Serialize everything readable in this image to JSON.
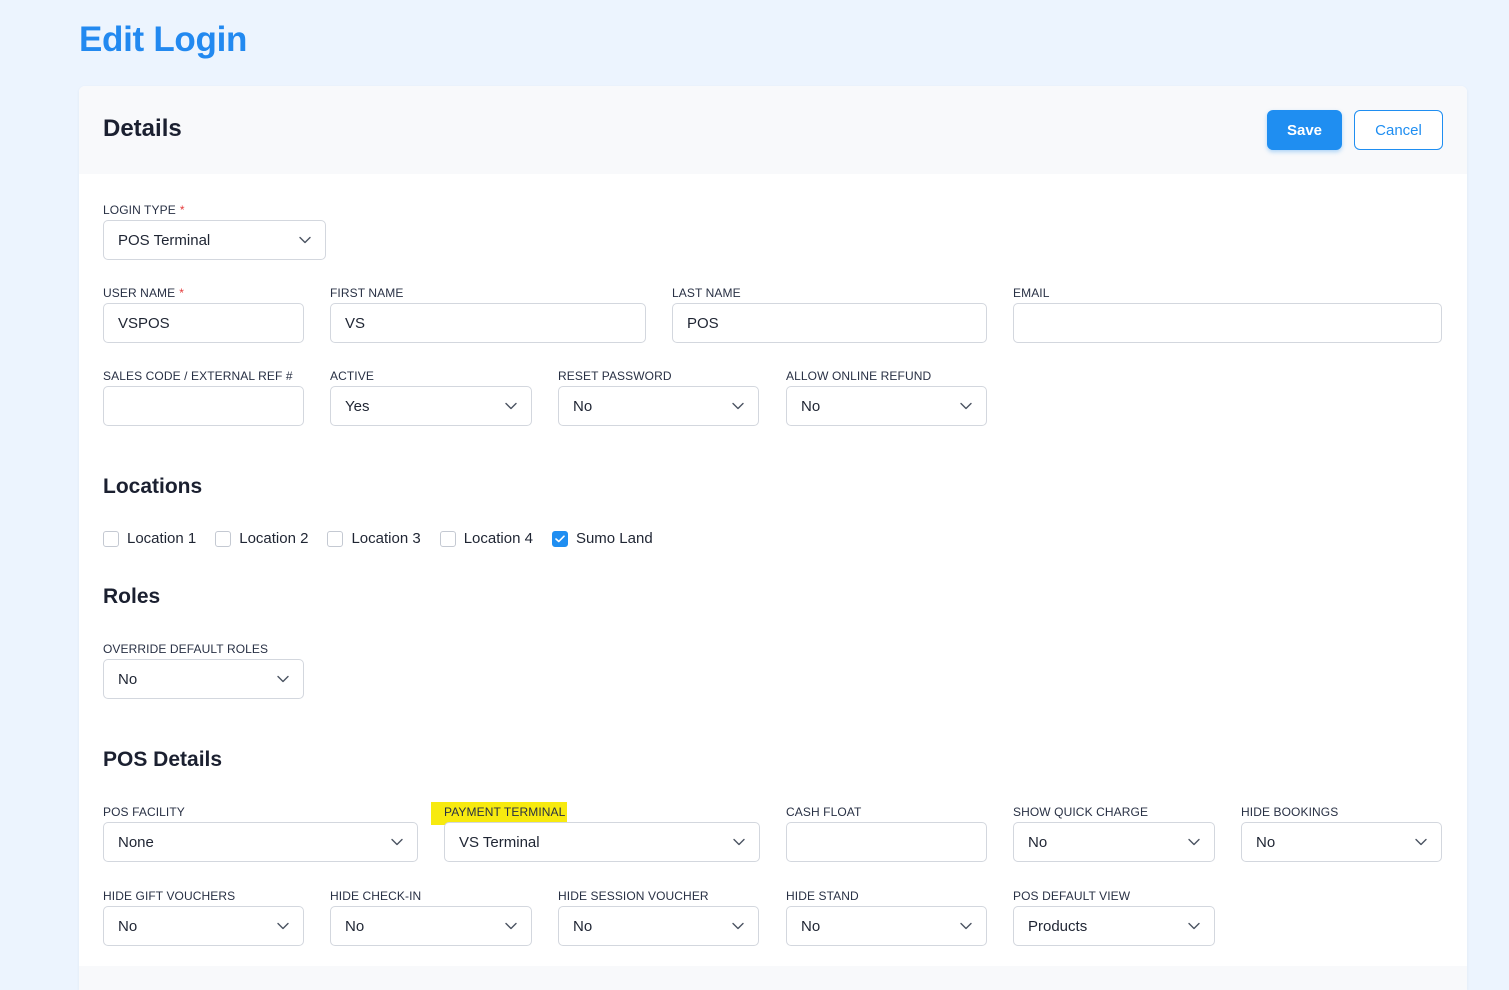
{
  "page": {
    "title": "Edit Login"
  },
  "card": {
    "title": "Details",
    "save_label": "Save",
    "cancel_label": "Cancel"
  },
  "fields": {
    "login_type": {
      "label": "LOGIN TYPE",
      "value": "POS Terminal",
      "required": "*"
    },
    "user_name": {
      "label": "USER NAME",
      "value": "VSPOS",
      "required": "*"
    },
    "first_name": {
      "label": "FIRST NAME",
      "value": "VS"
    },
    "last_name": {
      "label": "LAST NAME",
      "value": "POS"
    },
    "email": {
      "label": "EMAIL",
      "value": ""
    },
    "sales_code": {
      "label": "SALES CODE / EXTERNAL REF #",
      "value": ""
    },
    "active": {
      "label": "ACTIVE",
      "value": "Yes"
    },
    "reset_password": {
      "label": "RESET PASSWORD",
      "value": "No"
    },
    "allow_online_refund": {
      "label": "ALLOW ONLINE REFUND",
      "value": "No"
    }
  },
  "locations": {
    "title": "Locations",
    "items": [
      {
        "label": "Location 1",
        "checked": false
      },
      {
        "label": "Location 2",
        "checked": false
      },
      {
        "label": "Location 3",
        "checked": false
      },
      {
        "label": "Location 4",
        "checked": false
      },
      {
        "label": "Sumo Land",
        "checked": true
      }
    ]
  },
  "roles": {
    "title": "Roles",
    "override_default_roles": {
      "label": "OVERRIDE DEFAULT ROLES",
      "value": "No"
    }
  },
  "pos_details": {
    "title": "POS Details",
    "pos_facility": {
      "label": "POS FACILITY",
      "value": "None"
    },
    "payment_terminal": {
      "label": "PAYMENT TERMINAL",
      "value": "VS Terminal"
    },
    "cash_float": {
      "label": "CASH FLOAT",
      "value": ""
    },
    "show_quick_charge": {
      "label": "SHOW QUICK CHARGE",
      "value": "No"
    },
    "hide_bookings": {
      "label": "HIDE BOOKINGS",
      "value": "No"
    },
    "hide_gift_vouchers": {
      "label": "HIDE GIFT VOUCHERS",
      "value": "No"
    },
    "hide_check_in": {
      "label": "HIDE CHECK-IN",
      "value": "No"
    },
    "hide_session_voucher": {
      "label": "HIDE SESSION VOUCHER",
      "value": "No"
    },
    "hide_stand": {
      "label": "HIDE STAND",
      "value": "No"
    },
    "pos_default_view": {
      "label": "POS DEFAULT VIEW",
      "value": "Products"
    }
  },
  "colors": {
    "accent": "#1f8ef1",
    "title": "#2289f0",
    "highlight": "#f7ea0f",
    "required": "#e53b3b"
  }
}
